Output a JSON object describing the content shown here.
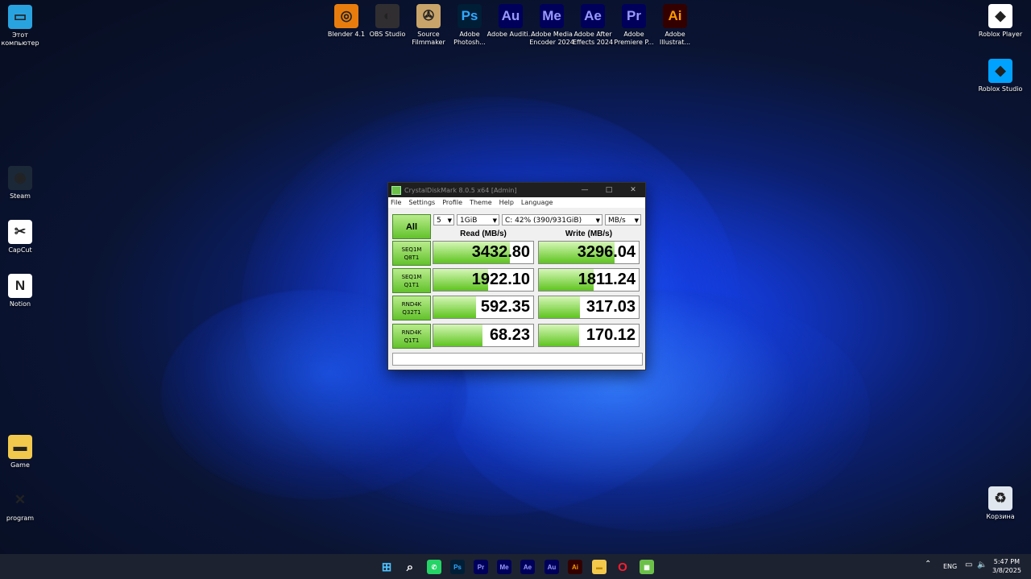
{
  "desktop_icons_left": [
    {
      "name": "this-pc",
      "label": "Этот компьютер",
      "glyph": "▭",
      "bg": "#29a3e0"
    },
    {
      "name": "steam",
      "label": "Steam",
      "glyph": "◉",
      "bg": "#1b2838"
    },
    {
      "name": "capcut",
      "label": "CapCut",
      "glyph": "✂",
      "bg": "#ffffff"
    },
    {
      "name": "notion",
      "label": "Notion",
      "glyph": "N",
      "bg": "#ffffff"
    },
    {
      "name": "game-folder",
      "label": "Game",
      "glyph": "▬",
      "bg": "#f2c94c"
    },
    {
      "name": "program",
      "label": "program",
      "glyph": "✕",
      "bg": "transparent"
    }
  ],
  "desktop_icons_top": [
    {
      "name": "blender",
      "label": "Blender 4.1",
      "glyph": "◎",
      "bg": "#e87d0d"
    },
    {
      "name": "obs-studio",
      "label": "OBS Studio",
      "glyph": "◐",
      "bg": "#302e31"
    },
    {
      "name": "source-filmmaker",
      "label": "Source Filmmaker",
      "glyph": "✇",
      "bg": "#c8a46a"
    },
    {
      "name": "adobe-photoshop",
      "label": "Adobe Photosh...",
      "glyph": "Ps",
      "bg": "#001e36",
      "fg": "#31a8ff"
    },
    {
      "name": "adobe-audition",
      "label": "Adobe Auditi...",
      "glyph": "Au",
      "bg": "#00005b",
      "fg": "#9999ff"
    },
    {
      "name": "adobe-media-encoder",
      "label": "Adobe Media Encoder 2024",
      "glyph": "Me",
      "bg": "#00005b",
      "fg": "#9999ff"
    },
    {
      "name": "adobe-after-effects",
      "label": "Adobe After Effects 2024",
      "glyph": "Ae",
      "bg": "#00005b",
      "fg": "#9999ff"
    },
    {
      "name": "adobe-premiere",
      "label": "Adobe Premiere P...",
      "glyph": "Pr",
      "bg": "#00005b",
      "fg": "#9999ff"
    },
    {
      "name": "adobe-illustrator",
      "label": "Adobe Illustrat...",
      "glyph": "Ai",
      "bg": "#330000",
      "fg": "#ff9a00"
    }
  ],
  "desktop_icons_right": [
    {
      "name": "roblox-player",
      "label": "Roblox Player",
      "glyph": "◆",
      "bg": "#ffffff"
    },
    {
      "name": "roblox-studio",
      "label": "Roblox Studio",
      "glyph": "◆",
      "bg": "#00a2ff"
    },
    {
      "name": "recycle-bin",
      "label": "Корзина",
      "glyph": "♻",
      "bg": "#dfe6ee"
    }
  ],
  "window": {
    "title": "CrystalDiskMark 8.0.5 x64 [Admin]",
    "controls": [
      "—",
      "□",
      "✕"
    ],
    "menu": [
      "File",
      "Settings",
      "Profile",
      "Theme",
      "Help",
      "Language"
    ],
    "all_button": "All",
    "count_select": "5",
    "size_select": "1GiB",
    "drive_select": "C: 42% (390/931GiB)",
    "unit_select": "MB/s",
    "read_header": "Read (MB/s)",
    "write_header": "Write (MB/s)",
    "rows": [
      {
        "l1": "SEQ1M",
        "l2": "Q8T1",
        "read": "3432.80",
        "write": "3296.04",
        "read_fill": 0.77,
        "write_fill": 0.76
      },
      {
        "l1": "SEQ1M",
        "l2": "Q1T1",
        "read": "1922.10",
        "write": "1811.24",
        "read_fill": 0.55,
        "write_fill": 0.55
      },
      {
        "l1": "RND4K",
        "l2": "Q32T1",
        "read": "592.35",
        "write": "317.03",
        "read_fill": 0.43,
        "write_fill": 0.41
      },
      {
        "l1": "RND4K",
        "l2": "Q1T1",
        "read": "68.23",
        "write": "170.12",
        "read_fill": 0.49,
        "write_fill": 0.4
      }
    ]
  },
  "taskbar": {
    "icons": [
      {
        "name": "start",
        "glyph": "⊞",
        "bg": "transparent",
        "fg": "#4cc2ff"
      },
      {
        "name": "search",
        "glyph": "⌕",
        "bg": "transparent",
        "fg": "#ffffff"
      },
      {
        "name": "whatsapp",
        "glyph": "✆",
        "bg": "#25d366",
        "fg": "#ffffff"
      },
      {
        "name": "photoshop",
        "glyph": "Ps",
        "bg": "#001e36",
        "fg": "#31a8ff"
      },
      {
        "name": "premiere",
        "glyph": "Pr",
        "bg": "#00005b",
        "fg": "#9999ff"
      },
      {
        "name": "media-encoder",
        "glyph": "Me",
        "bg": "#00005b",
        "fg": "#9999ff"
      },
      {
        "name": "after-effects",
        "glyph": "Ae",
        "bg": "#00005b",
        "fg": "#9999ff"
      },
      {
        "name": "audition",
        "glyph": "Au",
        "bg": "#00005b",
        "fg": "#9999ff"
      },
      {
        "name": "illustrator",
        "glyph": "Ai",
        "bg": "#330000",
        "fg": "#ff9a00"
      },
      {
        "name": "file-explorer",
        "glyph": "▬",
        "bg": "#f2c94c",
        "fg": "#c08a00"
      },
      {
        "name": "opera",
        "glyph": "O",
        "bg": "transparent",
        "fg": "#ff1b2d"
      },
      {
        "name": "crystaldiskmark",
        "glyph": "▦",
        "bg": "#6cc04a",
        "fg": "#ffffff"
      }
    ],
    "tray_chevron": "⌃",
    "language": "ENG",
    "time": "5:47 PM",
    "date": "3/8/2025"
  }
}
